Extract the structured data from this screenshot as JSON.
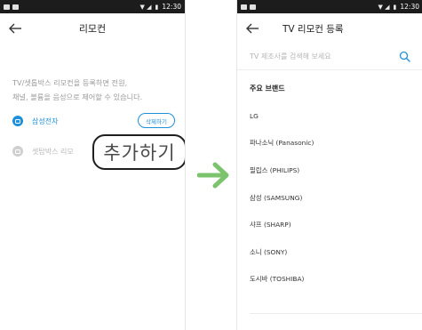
{
  "left_screen": {
    "status": {
      "time": "12:30",
      "signal_glyph": "▼ ◢",
      "battery_glyph": "▮"
    },
    "title": "리모컨",
    "description_line1": "TV/셋톱박스 리모컨을 등록하면 전원,",
    "description_line2": "채널, 볼륨을 음성으로 제어할 수 있습니다.",
    "devices": [
      {
        "name": "삼성전자",
        "active": true
      },
      {
        "name": "셋탑박스 리모",
        "active": false
      }
    ],
    "delete_label": "삭제하기",
    "add_label": "추가하기"
  },
  "right_screen": {
    "status": {
      "time": "12:30",
      "signal_glyph": "▼ ◢",
      "battery_glyph": "▮"
    },
    "title": "TV 리모컨 등록",
    "search_placeholder": "TV 제조사를 검색해 보세요",
    "section_title": "주요 브랜드",
    "brands": [
      "LG",
      "파나소닉 (Panasonic)",
      "필립스 (PHILIPS)",
      "삼성 (SAMSUNG)",
      "샤프 (SHARP)",
      "소니 (SONY)",
      "도시바 (TOSHIBA)"
    ]
  },
  "colors": {
    "accent_blue": "#1e8fd9",
    "arrow_green": "#7cc36e",
    "status_bar": "#1c1c1c"
  },
  "icons": {
    "back": "back-arrow-icon",
    "search": "search-icon",
    "device": "tv-device-icon",
    "transition": "right-arrow-icon"
  }
}
